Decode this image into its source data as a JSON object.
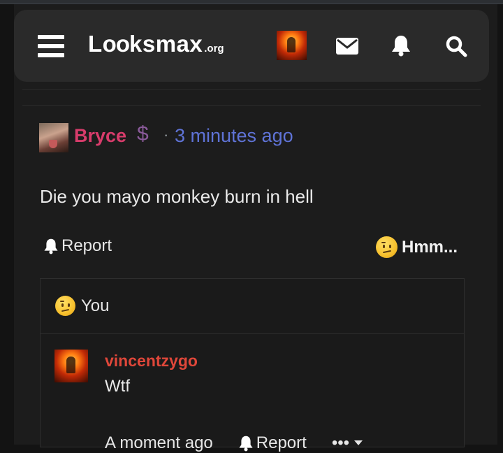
{
  "header": {
    "logo_main": "L",
    "logo_oo": "oo",
    "logo_rest": "ksmax",
    "logo_tld": ".org",
    "icons": [
      "menu-icon",
      "user-avatar",
      "envelope-icon",
      "bell-icon",
      "search-icon"
    ]
  },
  "comment": {
    "author": "Bryce",
    "badge_icon": "dollar-icon",
    "separator": "·",
    "timestamp": "3 minutes ago",
    "body": "Die you mayo monkey burn in hell",
    "report_label": "Report",
    "reaction_label": "Hmm..."
  },
  "reactions_panel": {
    "reactor_label": "You"
  },
  "reply": {
    "author": "vincentzygo",
    "body": "Wtf",
    "timestamp": "A moment ago",
    "report_label": "Report",
    "more_label": "•••"
  },
  "colors": {
    "author_color": "#d83c6b",
    "timestamp_color": "#5f73d6",
    "reply_author_color": "#e0473a",
    "background": "#1c1c1c",
    "navbar": "#2a2a2a"
  }
}
